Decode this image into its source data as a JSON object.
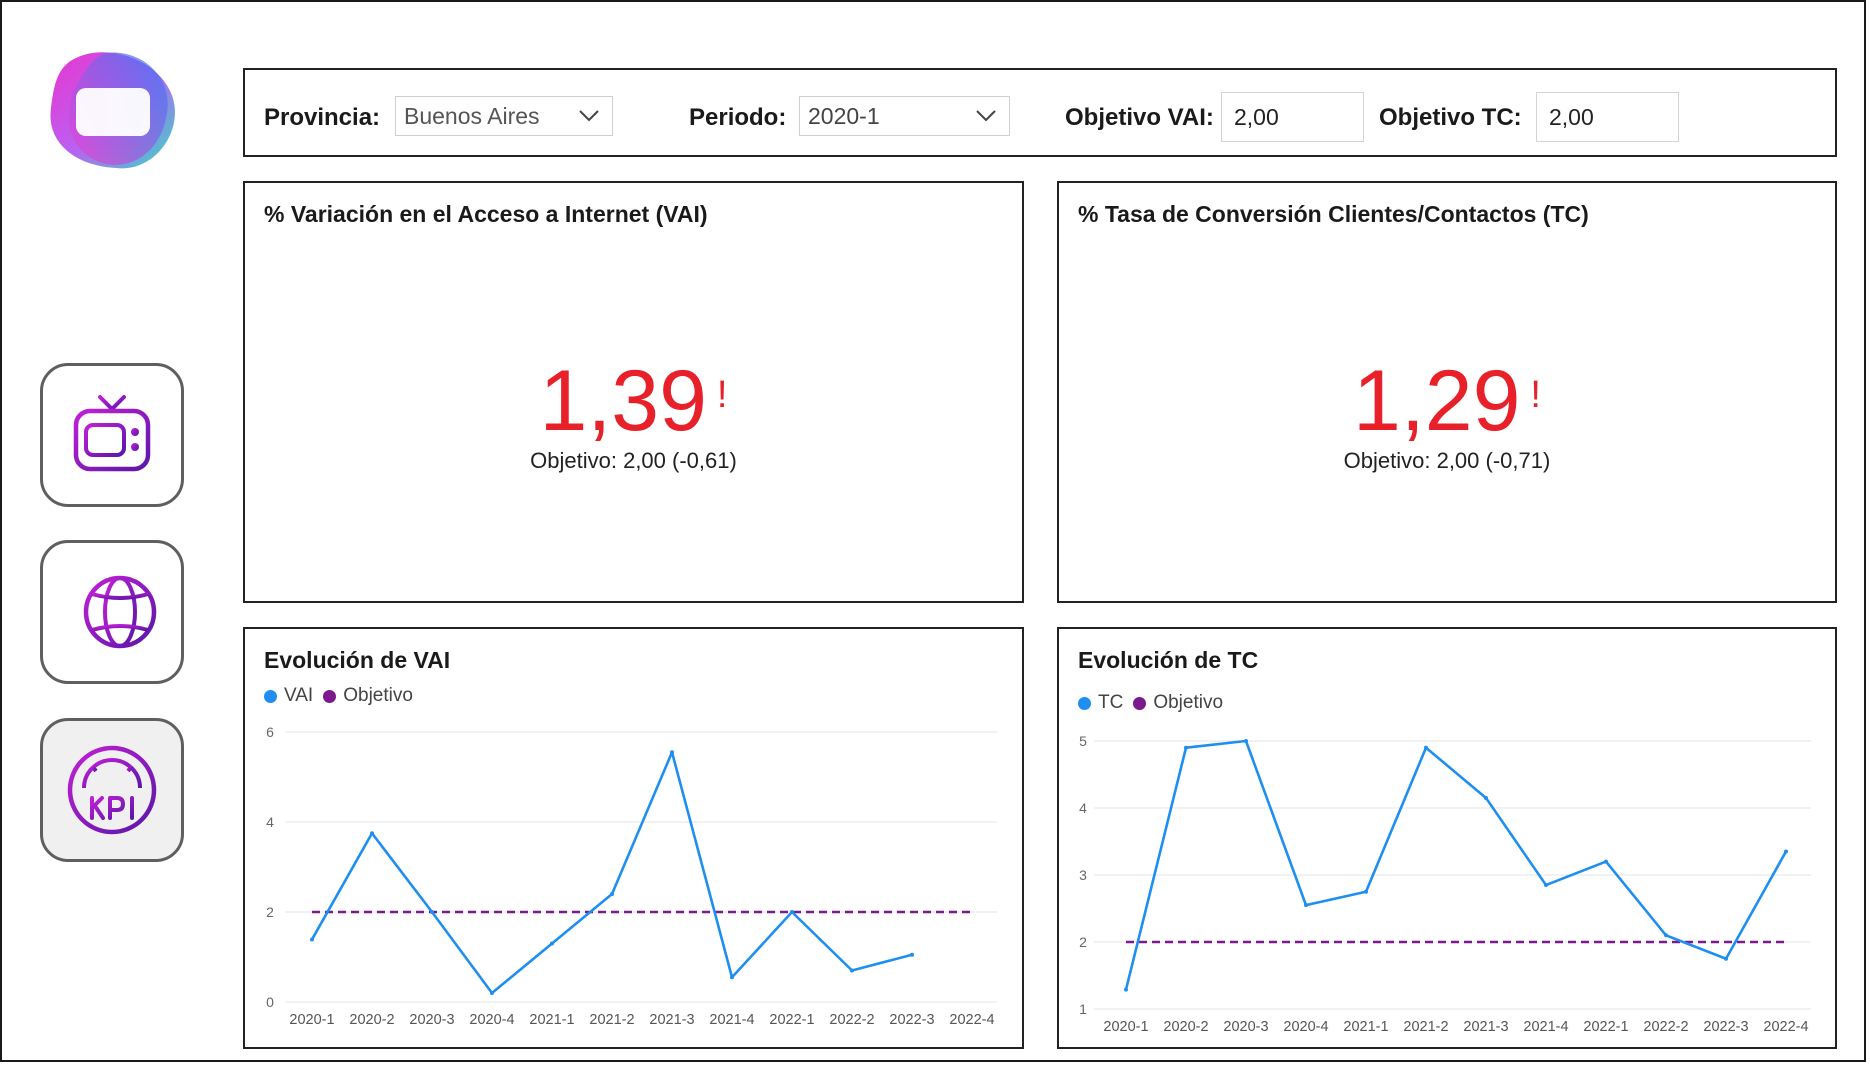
{
  "colors": {
    "series": "#1e8ff0",
    "target": "#7a1a8c",
    "kpi_alert": "#e8202a",
    "icon_purple": "#8a1bb5"
  },
  "nav": {
    "items": [
      {
        "icon": "tv-icon"
      },
      {
        "icon": "globe-icon"
      },
      {
        "icon": "kpi-gauge-icon",
        "active": true
      }
    ]
  },
  "filters": {
    "provincia_label": "Provincia:",
    "provincia_value": "Buenos Aires",
    "periodo_label": "Periodo:",
    "periodo_value": "2020-1",
    "obj_vai_label": "Objetivo VAI:",
    "obj_vai_value": "2,00",
    "obj_tc_label": "Objetivo TC:",
    "obj_tc_value": "2,00"
  },
  "kpis": {
    "vai": {
      "title": "% Variación en el Acceso a Internet (VAI)",
      "value": "1,39",
      "flag": "!",
      "target": "Objetivo: 2,00 (-0,61)"
    },
    "tc": {
      "title": "% Tasa de Conversión Clientes/Contactos (TC)",
      "value": "1,29",
      "flag": "!",
      "target": "Objetivo: 2,00 (-0,71)"
    }
  },
  "charts": {
    "vai": {
      "title": "Evolución de VAI",
      "legend_series": "VAI",
      "legend_target": "Objetivo"
    },
    "tc": {
      "title": "Evolución de TC",
      "legend_series": "TC",
      "legend_target": "Objetivo"
    }
  },
  "chart_data": [
    {
      "type": "line",
      "title": "Evolución de VAI",
      "x": [
        "2020-1",
        "2020-2",
        "2020-3",
        "2020-4",
        "2021-1",
        "2021-2",
        "2021-3",
        "2021-4",
        "2022-1",
        "2022-2",
        "2022-3",
        "2022-4"
      ],
      "series": [
        {
          "name": "VAI",
          "values": [
            1.39,
            3.75,
            2.0,
            0.2,
            1.3,
            2.4,
            5.55,
            0.55,
            2.0,
            0.7,
            1.05,
            null
          ]
        },
        {
          "name": "Objetivo",
          "values": [
            2,
            2,
            2,
            2,
            2,
            2,
            2,
            2,
            2,
            2,
            2,
            2
          ],
          "style": "dashed"
        }
      ],
      "ylim": [
        0,
        6
      ],
      "yticks": [
        0,
        2,
        4,
        6
      ],
      "grid": true,
      "legend": "top-left"
    },
    {
      "type": "line",
      "title": "Evolución de TC",
      "x": [
        "2020-1",
        "2020-2",
        "2020-3",
        "2020-4",
        "2021-1",
        "2021-2",
        "2021-3",
        "2021-4",
        "2022-1",
        "2022-2",
        "2022-3",
        "2022-4"
      ],
      "series": [
        {
          "name": "TC",
          "values": [
            1.29,
            4.9,
            5.0,
            2.55,
            2.75,
            4.9,
            4.15,
            2.85,
            3.2,
            2.1,
            1.75,
            3.35
          ]
        },
        {
          "name": "Objetivo",
          "values": [
            2,
            2,
            2,
            2,
            2,
            2,
            2,
            2,
            2,
            2,
            2,
            2
          ],
          "style": "dashed"
        }
      ],
      "ylim": [
        1,
        5
      ],
      "yticks": [
        1,
        2,
        3,
        4,
        5
      ],
      "grid": true,
      "legend": "top-left"
    }
  ]
}
